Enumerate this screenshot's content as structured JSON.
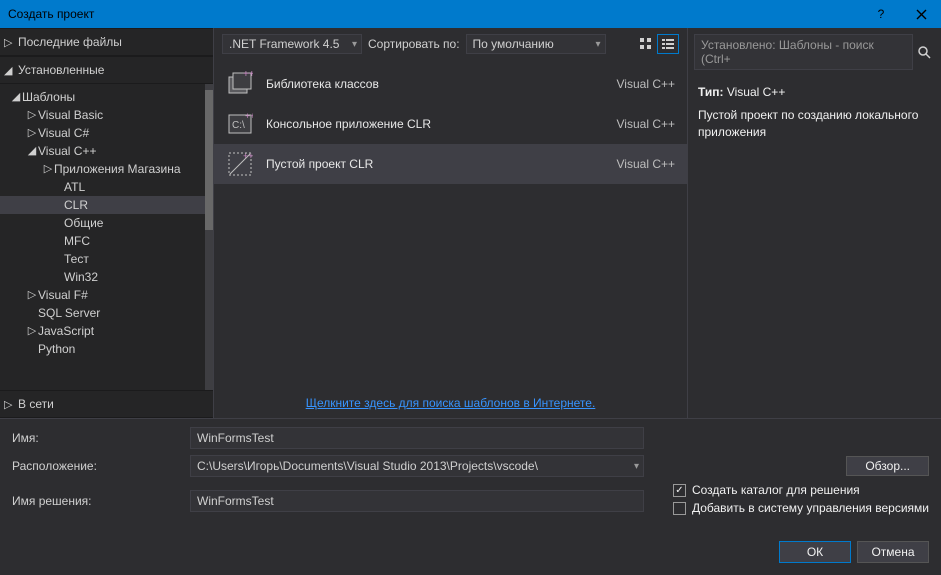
{
  "titlebar": {
    "title": "Создать проект"
  },
  "left": {
    "recent": "Последние файлы",
    "installed": "Установленные",
    "online": "В сети",
    "tree": {
      "templates": "Шаблоны",
      "vb": "Visual Basic",
      "cs": "Visual C#",
      "cpp": "Visual C++",
      "cpp_children": {
        "store": "Приложения Магазина",
        "atl": "ATL",
        "clr": "CLR",
        "general": "Общие",
        "mfc": "MFC",
        "test": "Тест",
        "win32": "Win32"
      },
      "fs": "Visual F#",
      "sql": "SQL Server",
      "js": "JavaScript",
      "py": "Python"
    }
  },
  "toolbar": {
    "framework": ".NET Framework 4.5",
    "sort_label": "Сортировать по:",
    "sort_value": "По умолчанию"
  },
  "search": {
    "placeholder": "Установлено: Шаблоны - поиск (Ctrl+"
  },
  "templates": [
    {
      "name": "Библиотека классов",
      "lang": "Visual C++"
    },
    {
      "name": "Консольное приложение CLR",
      "lang": "Visual C++"
    },
    {
      "name": "Пустой проект CLR",
      "lang": "Visual C++"
    }
  ],
  "online_link": "Щелкните здесь для поиска шаблонов в Интернете.",
  "info": {
    "type_label": "Тип:",
    "type_value": "Visual C++",
    "desc": "Пустой проект по созданию локального приложения"
  },
  "form": {
    "name_label": "Имя:",
    "name_value": "WinFormsTest",
    "location_label": "Расположение:",
    "location_value": "C:\\Users\\Игорь\\Documents\\Visual Studio 2013\\Projects\\vscode\\",
    "browse": "Обзор...",
    "solution_label": "Имя решения:",
    "solution_value": "WinFormsTest",
    "chk_create_dir": "Создать каталог для решения",
    "chk_add_source": "Добавить в систему управления версиями"
  },
  "buttons": {
    "ok": "ОК",
    "cancel": "Отмена"
  }
}
